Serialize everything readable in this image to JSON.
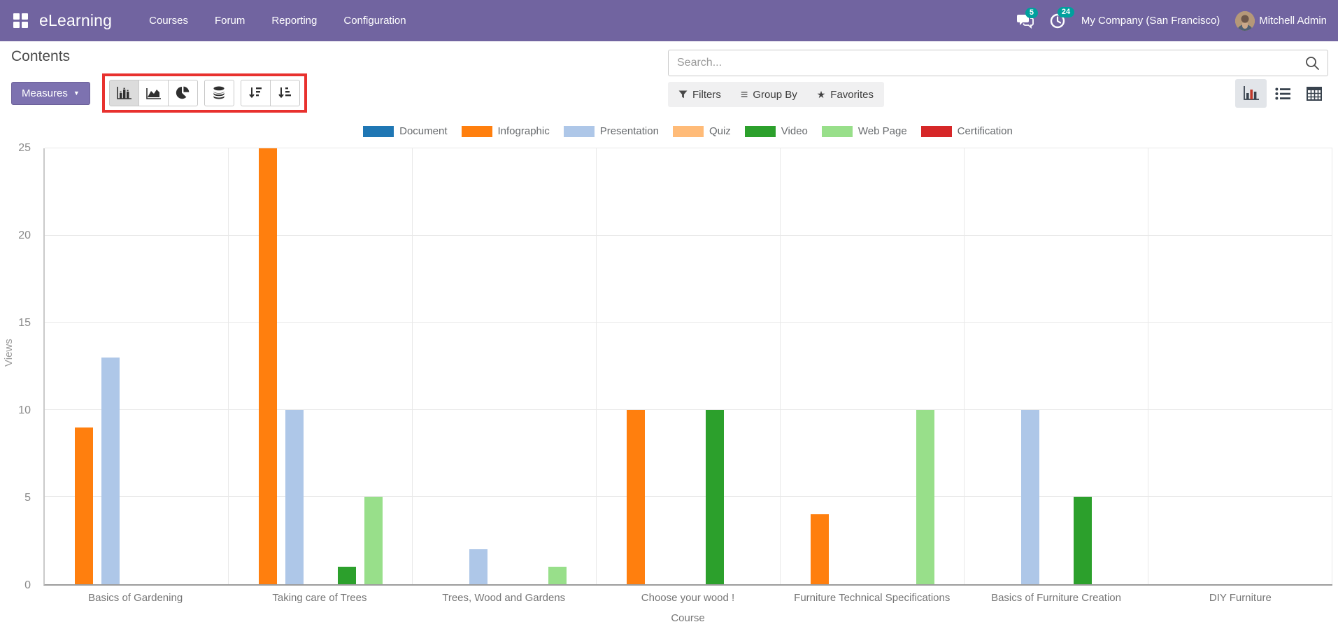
{
  "navbar": {
    "brand": "eLearning",
    "menu": [
      "Courses",
      "Forum",
      "Reporting",
      "Configuration"
    ],
    "messages_badge": "5",
    "activities_badge": "24",
    "company": "My Company (San Francisco)",
    "user": "Mitchell Admin"
  },
  "control_panel": {
    "title": "Contents",
    "measures_label": "Measures",
    "search_placeholder": "Search...",
    "search_value": "",
    "filters_label": "Filters",
    "group_by_label": "Group By",
    "favorites_label": "Favorites"
  },
  "icons": {
    "measures_caret": "▼",
    "group_by_glyph": "≡",
    "favorites_star": "★"
  },
  "colors": {
    "navbar_bg": "#7164a0",
    "primary_button": "#7d72b0",
    "badge_teal": "#00a09d",
    "highlight_red": "#e8312e"
  },
  "chart_data": {
    "type": "bar",
    "title": "",
    "xlabel": "Course",
    "ylabel": "Views",
    "ylim": [
      0,
      25
    ],
    "yticks": [
      0,
      5,
      10,
      15,
      20,
      25
    ],
    "grid": true,
    "legend_position": "top",
    "categories": [
      "Basics of Gardening",
      "Taking care of Trees",
      "Trees, Wood and Gardens",
      "Choose your wood !",
      "Furniture Technical Specifications",
      "Basics of Furniture Creation",
      "DIY Furniture"
    ],
    "series": [
      {
        "name": "Document",
        "color": "#1f77b4",
        "values": [
          0,
          0,
          0,
          0,
          0,
          0,
          0
        ]
      },
      {
        "name": "Infographic",
        "color": "#ff7f0e",
        "values": [
          9,
          25,
          0,
          10,
          4,
          0,
          0
        ]
      },
      {
        "name": "Presentation",
        "color": "#aec7e8",
        "values": [
          13,
          10,
          2,
          0,
          0,
          10,
          0
        ]
      },
      {
        "name": "Quiz",
        "color": "#ffbb78",
        "values": [
          0,
          0,
          0,
          0,
          0,
          0,
          0
        ]
      },
      {
        "name": "Video",
        "color": "#2ca02c",
        "values": [
          0,
          1,
          0,
          10,
          0,
          5,
          0
        ]
      },
      {
        "name": "Web Page",
        "color": "#98df8a",
        "values": [
          0,
          5,
          1,
          0,
          10,
          0,
          0
        ]
      },
      {
        "name": "Certification",
        "color": "#d62728",
        "values": [
          0,
          0,
          0,
          0,
          0,
          0,
          0
        ]
      }
    ]
  }
}
